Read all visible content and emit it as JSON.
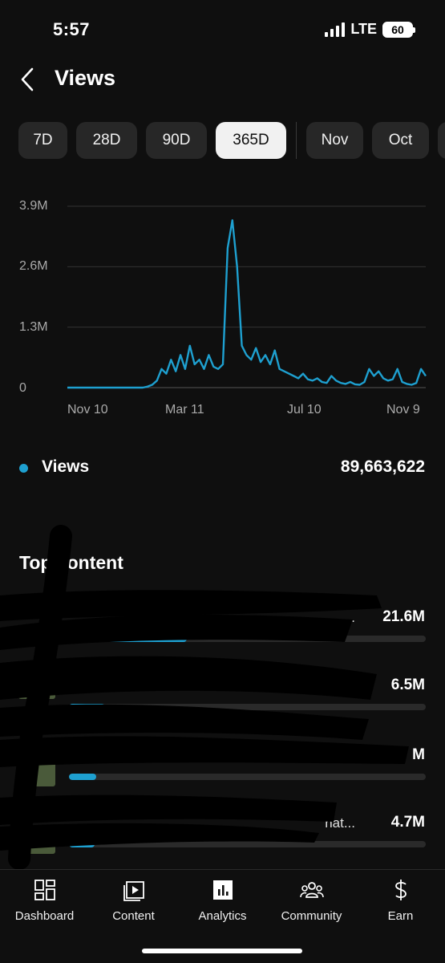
{
  "status": {
    "time": "5:57",
    "network": "LTE",
    "battery": "60"
  },
  "header": {
    "title": "Views",
    "back_icon": "chevron-left-icon"
  },
  "ranges": [
    {
      "label": "7D",
      "active": false
    },
    {
      "label": "28D",
      "active": false
    },
    {
      "label": "90D",
      "active": false
    },
    {
      "label": "365D",
      "active": true
    },
    {
      "label": "Nov",
      "active": false
    },
    {
      "label": "Oct",
      "active": false
    },
    {
      "label": "",
      "active": false
    }
  ],
  "chart_data": {
    "type": "line",
    "x_ticks": [
      "Nov 10",
      "Mar 11",
      "Jul 10",
      "Nov 9"
    ],
    "y_ticks": [
      "3.9M",
      "2.6M",
      "1.3M",
      "0"
    ],
    "ylim": [
      0,
      3900000
    ],
    "grid": true,
    "color": "#1ea0d0",
    "series": [
      {
        "x": [
          "Nov 10",
          "Dec 1",
          "Dec 22",
          "Jan 12",
          "Feb 2",
          "Feb 16",
          "Feb 23",
          "Mar 2",
          "Mar 6",
          "Mar 11",
          "Mar 15",
          "Mar 18",
          "Mar 21",
          "Mar 25",
          "Mar 28",
          "Apr 1",
          "Apr 4",
          "Apr 8",
          "Apr 11",
          "Apr 15",
          "Apr 18",
          "Apr 20",
          "Apr 22",
          "Apr 24",
          "Apr 25",
          "Apr 27",
          "Apr 29",
          "May 1",
          "May 4",
          "May 7",
          "May 10",
          "May 13",
          "May 16",
          "May 19",
          "May 22",
          "May 26",
          "May 30",
          "Jun 3",
          "Jun 8",
          "Jun 13",
          "Jun 18",
          "Jun 23",
          "Jun 28",
          "Jul 3",
          "Jul 10",
          "Jul 17",
          "Jul 24",
          "Jul 31",
          "Aug 7",
          "Aug 14",
          "Aug 21",
          "Aug 28",
          "Sep 4",
          "Sep 11",
          "Sep 18",
          "Sep 25",
          "Oct 2",
          "Oct 9",
          "Oct 16",
          "Oct 23",
          "Oct 30",
          "Nov 3",
          "Nov 5",
          "Nov 7",
          "Nov 9"
        ],
        "y": [
          0,
          0,
          0,
          0,
          0,
          20000,
          60000,
          150000,
          400000,
          300000,
          600000,
          350000,
          700000,
          400000,
          900000,
          500000,
          600000,
          400000,
          700000,
          450000,
          400000,
          500000,
          3000000,
          3600000,
          2600000,
          900000,
          700000,
          600000,
          850000,
          550000,
          700000,
          500000,
          800000,
          400000,
          350000,
          300000,
          250000,
          200000,
          300000,
          180000,
          150000,
          200000,
          120000,
          100000,
          250000,
          150000,
          100000,
          80000,
          120000,
          70000,
          60000,
          120000,
          400000,
          250000,
          350000,
          200000,
          150000,
          180000,
          400000,
          120000,
          80000,
          60000,
          100000,
          400000,
          250000
        ]
      }
    ]
  },
  "metric": {
    "label": "Views",
    "value": "89,663,622"
  },
  "top_content": {
    "title": "Top content",
    "items": [
      {
        "title": "...",
        "value": "21.6M",
        "fraction": 0.33
      },
      {
        "title": ".",
        "value": "6.5M",
        "fraction": 0.1
      },
      {
        "title": "",
        "value": "M",
        "fraction": 0.076
      },
      {
        "title": "hat...",
        "value": "4.7M",
        "fraction": 0.072
      }
    ]
  },
  "nav": [
    {
      "label": "Dashboard",
      "icon": "dashboard-icon"
    },
    {
      "label": "Content",
      "icon": "content-icon"
    },
    {
      "label": "Analytics",
      "icon": "analytics-icon"
    },
    {
      "label": "Community",
      "icon": "community-icon"
    },
    {
      "label": "Earn",
      "icon": "earn-icon"
    }
  ]
}
